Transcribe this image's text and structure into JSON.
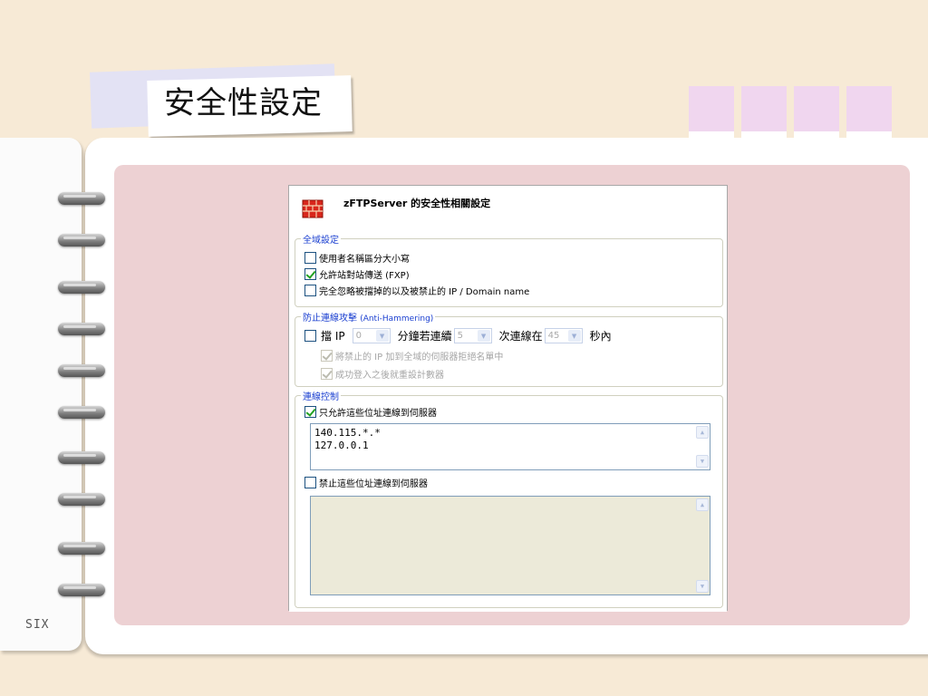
{
  "slide": {
    "title": "安全性設定",
    "page_label": "SIX"
  },
  "dialog": {
    "title": "zFTPServer 的安全性相關設定",
    "global": {
      "label": "全域設定",
      "options": [
        {
          "label": "使用者名稱區分大小寫",
          "checked": false
        },
        {
          "label": "允許站對站傳送 (FXP)",
          "checked": true
        },
        {
          "label": "完全忽略被擋掉的以及被禁止的 IP / Domain name",
          "checked": false
        }
      ]
    },
    "anti": {
      "label": "防止連線攻擊",
      "label_en": "(Anti-Hammering)",
      "block_label": "擋 IP",
      "minutes_value": "0",
      "minutes_label": "分鐘若連續",
      "count_value": "5",
      "count_label": "次連線在",
      "seconds_value": "45",
      "seconds_label": "秒內",
      "suboptions": [
        {
          "label": "將禁止的 IP 加到全域的伺服器拒絕名單中",
          "checked": true
        },
        {
          "label": "成功登入之後就重設計數器",
          "checked": true
        }
      ]
    },
    "connection": {
      "label": "連線控制",
      "allow_label": "只允許這些位址連線到伺服器",
      "allow_checked": true,
      "allow_list": [
        "140.115.*.*",
        "127.0.0.1"
      ],
      "deny_label": "禁止這些位址連線到伺服器",
      "deny_checked": false
    }
  },
  "colors": {
    "background": "#f7ead6",
    "pink_panel": "#edd1d3",
    "tab": "#f0d6ef",
    "group_label": "#1a3fd0"
  }
}
